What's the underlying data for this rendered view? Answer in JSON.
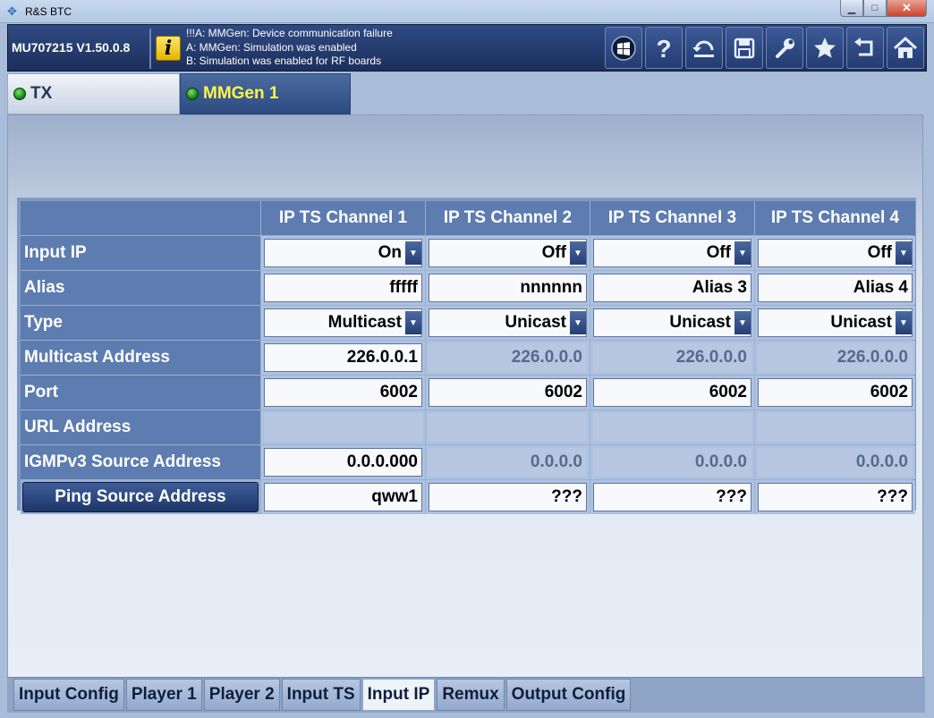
{
  "window": {
    "title": "R&S BTC",
    "minimize": "▁",
    "maximize": "□",
    "close": "✕"
  },
  "header": {
    "device": "MU707215 V1.50.0.8",
    "info_glyph": "i",
    "messages": [
      "!!!A: MMGen: Device communication failure",
      "A: MMGen: Simulation was enabled",
      "B: Simulation was enabled for RF boards"
    ],
    "toolbar": [
      "windows-icon",
      "help-icon",
      "undo-icon",
      "save-icon",
      "settings-wrench-icon",
      "favorites-star-icon",
      "back-icon",
      "home-icon"
    ]
  },
  "top_tabs": [
    {
      "label": "TX",
      "status": "green"
    },
    {
      "label": "MMGen 1",
      "status": "green"
    }
  ],
  "table": {
    "columns": [
      "IP TS Channel 1",
      "IP TS Channel 2",
      "IP TS Channel 3",
      "IP TS Channel 4"
    ],
    "rows": [
      {
        "label": "Input IP",
        "cells": [
          {
            "value": "On",
            "kind": "dropdown"
          },
          {
            "value": "Off",
            "kind": "dropdown"
          },
          {
            "value": "Off",
            "kind": "dropdown"
          },
          {
            "value": "Off",
            "kind": "dropdown"
          }
        ]
      },
      {
        "label": "Alias",
        "cells": [
          {
            "value": "fffff",
            "kind": "text"
          },
          {
            "value": "nnnnnn",
            "kind": "text"
          },
          {
            "value": "Alias 3",
            "kind": "text"
          },
          {
            "value": "Alias 4",
            "kind": "text"
          }
        ]
      },
      {
        "label": "Type",
        "cells": [
          {
            "value": "Multicast",
            "kind": "dropdown"
          },
          {
            "value": "Unicast",
            "kind": "dropdown"
          },
          {
            "value": "Unicast",
            "kind": "dropdown"
          },
          {
            "value": "Unicast",
            "kind": "dropdown"
          }
        ]
      },
      {
        "label": "Multicast Address",
        "cells": [
          {
            "value": "226.0.0.1",
            "kind": "text"
          },
          {
            "value": "226.0.0.0",
            "kind": "disabled"
          },
          {
            "value": "226.0.0.0",
            "kind": "disabled"
          },
          {
            "value": "226.0.0.0",
            "kind": "disabled"
          }
        ]
      },
      {
        "label": "Port",
        "cells": [
          {
            "value": "6002",
            "kind": "text"
          },
          {
            "value": "6002",
            "kind": "text"
          },
          {
            "value": "6002",
            "kind": "text"
          },
          {
            "value": "6002",
            "kind": "text"
          }
        ]
      },
      {
        "label": "URL Address",
        "cells": [
          {
            "value": "",
            "kind": "empty"
          },
          {
            "value": "",
            "kind": "empty"
          },
          {
            "value": "",
            "kind": "empty"
          },
          {
            "value": "",
            "kind": "empty"
          }
        ]
      },
      {
        "label": "IGMPv3 Source Address",
        "cells": [
          {
            "value": "0.0.0.000",
            "kind": "text"
          },
          {
            "value": "0.0.0.0",
            "kind": "disabled"
          },
          {
            "value": "0.0.0.0",
            "kind": "disabled"
          },
          {
            "value": "0.0.0.0",
            "kind": "disabled"
          }
        ]
      },
      {
        "label": "Ping Source Address",
        "is_button": true,
        "cells": [
          {
            "value": "qww1",
            "kind": "text"
          },
          {
            "value": "???",
            "kind": "text"
          },
          {
            "value": "???",
            "kind": "text"
          },
          {
            "value": "???",
            "kind": "text"
          }
        ]
      }
    ]
  },
  "bottom_tabs": [
    "Input Config",
    "Player 1",
    "Player 2",
    "Input TS",
    "Input IP",
    "Remux",
    "Output Config"
  ],
  "active_bottom_tab": "Input IP",
  "colors": {
    "header_bg": "#2a4478",
    "active_tab_text": "#fff54a",
    "led_green": "#2fb52a"
  }
}
